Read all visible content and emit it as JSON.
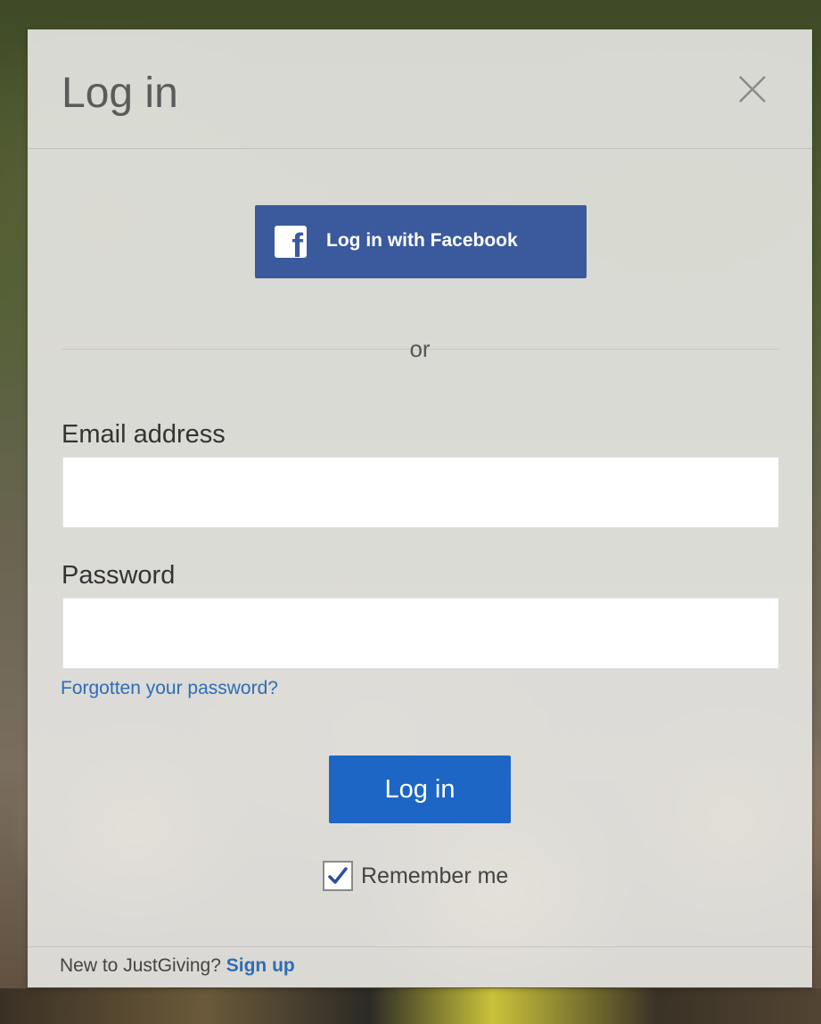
{
  "modal": {
    "title": "Log in",
    "close_icon": "close-icon"
  },
  "facebook": {
    "label": "Log in with Facebook",
    "icon": "facebook-icon",
    "color": "#3b5a9d"
  },
  "divider": {
    "text": "or"
  },
  "email": {
    "label": "Email address",
    "value": "",
    "placeholder": ""
  },
  "password": {
    "label": "Password",
    "value": "",
    "placeholder": ""
  },
  "forgot_password": {
    "label": "Forgotten your password?"
  },
  "submit": {
    "label": "Log in",
    "color": "#1e66c6"
  },
  "remember_me": {
    "label": "Remember me",
    "checked": true
  },
  "footer": {
    "prompt": "New to JustGiving?",
    "signup_label": "Sign up"
  },
  "link_color": "#2e6db4"
}
